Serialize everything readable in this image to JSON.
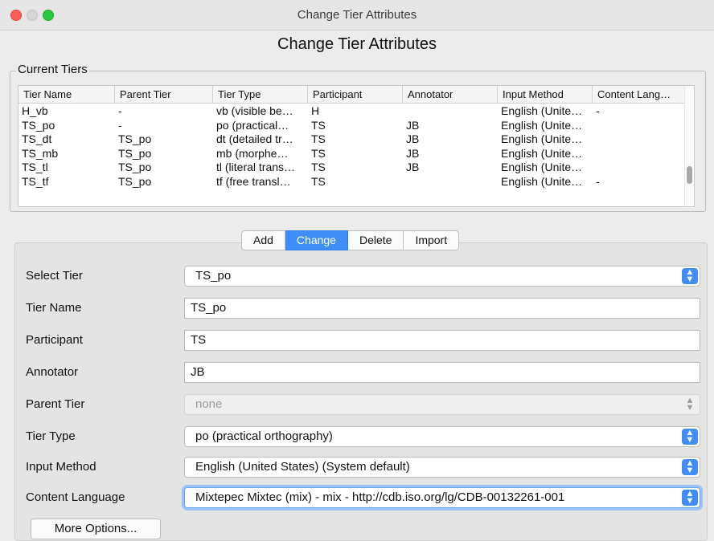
{
  "window": {
    "title": "Change Tier Attributes"
  },
  "heading": "Change Tier Attributes",
  "current_tiers": {
    "label": "Current Tiers",
    "columns": [
      "Tier Name",
      "Parent Tier",
      "Tier Type",
      "Participant",
      "Annotator",
      "Input Method",
      "Content Lang…"
    ],
    "rows": [
      [
        "H_vb",
        "-",
        "vb (visible be…",
        "H",
        "",
        "English (Unite…",
        "-"
      ],
      [
        "TS_po",
        "-",
        "po (practical…",
        "TS",
        "JB",
        "English (Unite…",
        ""
      ],
      [
        "TS_dt",
        "TS_po",
        "dt (detailed tr…",
        "TS",
        "JB",
        "English (Unite…",
        ""
      ],
      [
        "TS_mb",
        "TS_po",
        "mb (morphe…",
        "TS",
        "JB",
        "English (Unite…",
        ""
      ],
      [
        "TS_tl",
        "TS_po",
        "tl (literal trans…",
        "TS",
        "JB",
        "English (Unite…",
        ""
      ],
      [
        "TS_tf",
        "TS_po",
        "tf (free transl…",
        "TS",
        "",
        "English (Unite…",
        "-"
      ]
    ]
  },
  "tabs": [
    "Add",
    "Change",
    "Delete",
    "Import"
  ],
  "form": {
    "select_tier": {
      "label": "Select Tier",
      "value": "TS_po"
    },
    "tier_name": {
      "label": "Tier Name",
      "value": "TS_po"
    },
    "participant": {
      "label": "Participant",
      "value": "TS"
    },
    "annotator": {
      "label": "Annotator",
      "value": "JB"
    },
    "parent_tier": {
      "label": "Parent Tier",
      "value": "none"
    },
    "tier_type": {
      "label": "Tier Type",
      "value": "po (practical orthography)"
    },
    "input_method": {
      "label": "Input Method",
      "value": "English (United States) (System default)"
    },
    "content_language": {
      "label": "Content Language",
      "value": "Mixtepec Mixtec (mix) - mix - http://cdb.iso.org/lg/CDB-00132261-001"
    }
  },
  "more_options_label": "More Options...",
  "colors": {
    "accent": "#3f8ef7",
    "close": "#ff5f57",
    "zoom": "#28c840"
  }
}
